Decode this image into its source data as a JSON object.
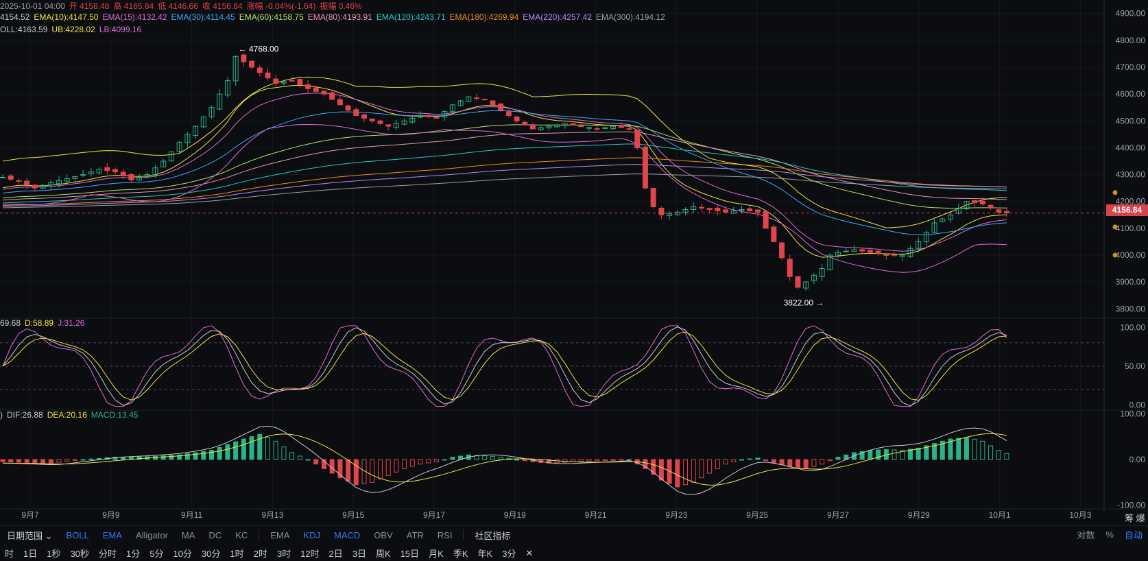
{
  "header": {
    "row1": [
      {
        "text": "2025-10-01 04:00",
        "color": "#9aa0a8"
      },
      {
        "text": "开 4158.48",
        "color": "#e0444d"
      },
      {
        "text": "高 4165.84",
        "color": "#e0444d"
      },
      {
        "text": "低 4146.66",
        "color": "#e0444d"
      },
      {
        "text": "收 4156.84",
        "color": "#e0444d"
      },
      {
        "text": "涨幅 -0.04%(-1.64)",
        "color": "#e0444d"
      },
      {
        "text": "振幅 0.46%",
        "color": "#e0444d"
      }
    ],
    "row2": [
      {
        "text": "4154.52",
        "color": "#c9ccd2"
      },
      {
        "text": "EMA(10):4147.50",
        "color": "#f0e442"
      },
      {
        "text": "EMA(15):4132.42",
        "color": "#e06cd6"
      },
      {
        "text": "EMA(30):4114.45",
        "color": "#3fa9f5"
      },
      {
        "text": "EMA(60):4158.75",
        "color": "#b7e36e"
      },
      {
        "text": "EMA(80):4193.91",
        "color": "#e89ab0"
      },
      {
        "text": "EMA(120):4243.71",
        "color": "#27c7c9"
      },
      {
        "text": "EMA(180):4269.94",
        "color": "#f08a24"
      },
      {
        "text": "EMA(220):4257.42",
        "color": "#b58cf0"
      },
      {
        "text": "EMA(300):4194.12",
        "color": "#9aa0a8"
      }
    ],
    "row3": [
      {
        "text": "OLL:4163.59",
        "color": "#c9ccd2"
      },
      {
        "text": "UB:4228.02",
        "color": "#f0e442"
      },
      {
        "text": "LB:4099.16",
        "color": "#e06cd6"
      }
    ],
    "kdj_row": [
      {
        "text": "69.68",
        "color": "#c9ccd2"
      },
      {
        "text": "D:58.89",
        "color": "#f0e442"
      },
      {
        "text": "J:31.26",
        "color": "#e06cd6"
      }
    ],
    "macd_row": [
      {
        "text": ")",
        "color": "#c9ccd2"
      },
      {
        "text": "DIF:26.88",
        "color": "#c9ccd2"
      },
      {
        "text": "DEA:20.16",
        "color": "#f0e442"
      },
      {
        "text": "MACD:13.45",
        "color": "#29b38a"
      }
    ]
  },
  "chart_data": [
    {
      "type": "candlestick",
      "x_labels": [
        "9月7",
        "9月9",
        "9月11",
        "9月13",
        "9月15",
        "9月17",
        "9月19",
        "9月21",
        "9月23",
        "9月25",
        "9月27",
        "9月29",
        "10月1",
        "10月3"
      ],
      "y_ticks": [
        "4900.00",
        "4800.00",
        "4700.00",
        "4600.00",
        "4500.00",
        "4400.00",
        "4300.00",
        "4200.00",
        "4100.00",
        "4000.00",
        "3900.00",
        "3800.00"
      ],
      "ylim": [
        3770,
        4930
      ],
      "close_path": [
        [
          0,
          4290
        ],
        [
          2,
          4275
        ],
        [
          4,
          4250
        ],
        [
          6,
          4270
        ],
        [
          8,
          4285
        ],
        [
          10,
          4300
        ],
        [
          12,
          4320
        ],
        [
          14,
          4310
        ],
        [
          16,
          4280
        ],
        [
          18,
          4300
        ],
        [
          20,
          4350
        ],
        [
          22,
          4420
        ],
        [
          24,
          4480
        ],
        [
          26,
          4550
        ],
        [
          28,
          4650
        ],
        [
          29,
          4740
        ],
        [
          30,
          4720
        ],
        [
          32,
          4680
        ],
        [
          34,
          4640
        ],
        [
          36,
          4650
        ],
        [
          38,
          4620
        ],
        [
          40,
          4600
        ],
        [
          42,
          4560
        ],
        [
          44,
          4520
        ],
        [
          46,
          4500
        ],
        [
          48,
          4480
        ],
        [
          50,
          4500
        ],
        [
          52,
          4520
        ],
        [
          54,
          4510
        ],
        [
          56,
          4560
        ],
        [
          58,
          4590
        ],
        [
          60,
          4580
        ],
        [
          62,
          4540
        ],
        [
          64,
          4500
        ],
        [
          66,
          4470
        ],
        [
          68,
          4480
        ],
        [
          70,
          4490
        ],
        [
          72,
          4480
        ],
        [
          74,
          4470
        ],
        [
          76,
          4480
        ],
        [
          78,
          4470
        ],
        [
          79,
          4400
        ],
        [
          80,
          4250
        ],
        [
          81,
          4180
        ],
        [
          82,
          4150
        ],
        [
          84,
          4160
        ],
        [
          86,
          4180
        ],
        [
          88,
          4170
        ],
        [
          90,
          4160
        ],
        [
          92,
          4170
        ],
        [
          94,
          4160
        ],
        [
          95,
          4100
        ],
        [
          96,
          4050
        ],
        [
          97,
          3990
        ],
        [
          98,
          3920
        ],
        [
          99,
          3880
        ],
        [
          100,
          3900
        ],
        [
          102,
          3950
        ],
        [
          103,
          4000
        ],
        [
          104,
          4010
        ],
        [
          106,
          4020
        ],
        [
          108,
          4010
        ],
        [
          110,
          4000
        ],
        [
          112,
          4000
        ],
        [
          114,
          4050
        ],
        [
          116,
          4120
        ],
        [
          118,
          4150
        ],
        [
          120,
          4200
        ],
        [
          122,
          4190
        ],
        [
          124,
          4160
        ],
        [
          125,
          4157
        ]
      ],
      "annotations": [
        {
          "text": "← 4768.00"
        },
        {
          "text": "3822.00 →"
        }
      ],
      "last_price": "4156.84",
      "dashed_line_value": 4156.84
    },
    {
      "type": "line",
      "name_row": "KDJ",
      "y_ticks": [
        "100.00",
        "50.00",
        "0.00"
      ],
      "ylim": [
        -5,
        110
      ],
      "ref_lines": [
        80,
        50,
        20
      ]
    },
    {
      "type": "bar",
      "name_row": "MACD",
      "y_ticks": [
        "100.00",
        "0.00",
        "-100.00"
      ],
      "ylim": [
        -105,
        105
      ],
      "histogram_path": [
        [
          0,
          -5
        ],
        [
          6,
          -8
        ],
        [
          10,
          0
        ],
        [
          14,
          5
        ],
        [
          18,
          6
        ],
        [
          22,
          10
        ],
        [
          26,
          20
        ],
        [
          30,
          45
        ],
        [
          32,
          55
        ],
        [
          34,
          40
        ],
        [
          36,
          15
        ],
        [
          38,
          0
        ],
        [
          40,
          -20
        ],
        [
          42,
          -40
        ],
        [
          44,
          -55
        ],
        [
          46,
          -50
        ],
        [
          48,
          -35
        ],
        [
          50,
          -20
        ],
        [
          52,
          -10
        ],
        [
          54,
          -5
        ],
        [
          56,
          5
        ],
        [
          58,
          10
        ],
        [
          60,
          8
        ],
        [
          62,
          5
        ],
        [
          64,
          0
        ],
        [
          66,
          -5
        ],
        [
          68,
          -8
        ],
        [
          70,
          -6
        ],
        [
          72,
          -4
        ],
        [
          74,
          -3
        ],
        [
          76,
          -2
        ],
        [
          78,
          0
        ],
        [
          80,
          -20
        ],
        [
          82,
          -45
        ],
        [
          84,
          -60
        ],
        [
          86,
          -50
        ],
        [
          88,
          -30
        ],
        [
          90,
          -10
        ],
        [
          92,
          0
        ],
        [
          94,
          3
        ],
        [
          96,
          -8
        ],
        [
          98,
          -15
        ],
        [
          100,
          -20
        ],
        [
          102,
          -10
        ],
        [
          104,
          5
        ],
        [
          106,
          15
        ],
        [
          108,
          20
        ],
        [
          110,
          22
        ],
        [
          112,
          20
        ],
        [
          114,
          25
        ],
        [
          116,
          35
        ],
        [
          118,
          45
        ],
        [
          120,
          48
        ],
        [
          122,
          40
        ],
        [
          124,
          20
        ],
        [
          125,
          13
        ]
      ]
    }
  ],
  "right_dots": [
    "#c8941e",
    "#c8941e",
    "#c8941e"
  ],
  "toolbar": {
    "items": [
      {
        "label": "日期范围 ⌄",
        "on": false,
        "white": true
      },
      {
        "label": "BOLL",
        "on": true
      },
      {
        "label": "EMA",
        "on": true
      },
      {
        "label": "Alligator",
        "on": false
      },
      {
        "label": "MA",
        "on": false
      },
      {
        "label": "DC",
        "on": false
      },
      {
        "label": "KC",
        "on": false
      },
      {
        "label": "EMA",
        "on": false
      },
      {
        "label": "KDJ",
        "on": true
      },
      {
        "label": "MACD",
        "on": true
      },
      {
        "label": "OBV",
        "on": false
      },
      {
        "label": "ATR",
        "on": false
      },
      {
        "label": "RSI",
        "on": false
      },
      {
        "label": "社区指标",
        "on": false,
        "white": true
      }
    ],
    "right": [
      {
        "label": "对数",
        "on": false
      },
      {
        "label": "%",
        "on": false
      },
      {
        "label": "自动",
        "on": true
      }
    ]
  },
  "timeframes": [
    "时",
    "1日",
    "1秒",
    "30秒",
    "分时",
    "1分",
    "5分",
    "10分",
    "30分",
    "1时",
    "2时",
    "3时",
    "12时",
    "2日",
    "3日",
    "周K",
    "15日",
    "月K",
    "季K",
    "年K",
    "3分",
    "✕"
  ],
  "corner_label": "筹 爆"
}
